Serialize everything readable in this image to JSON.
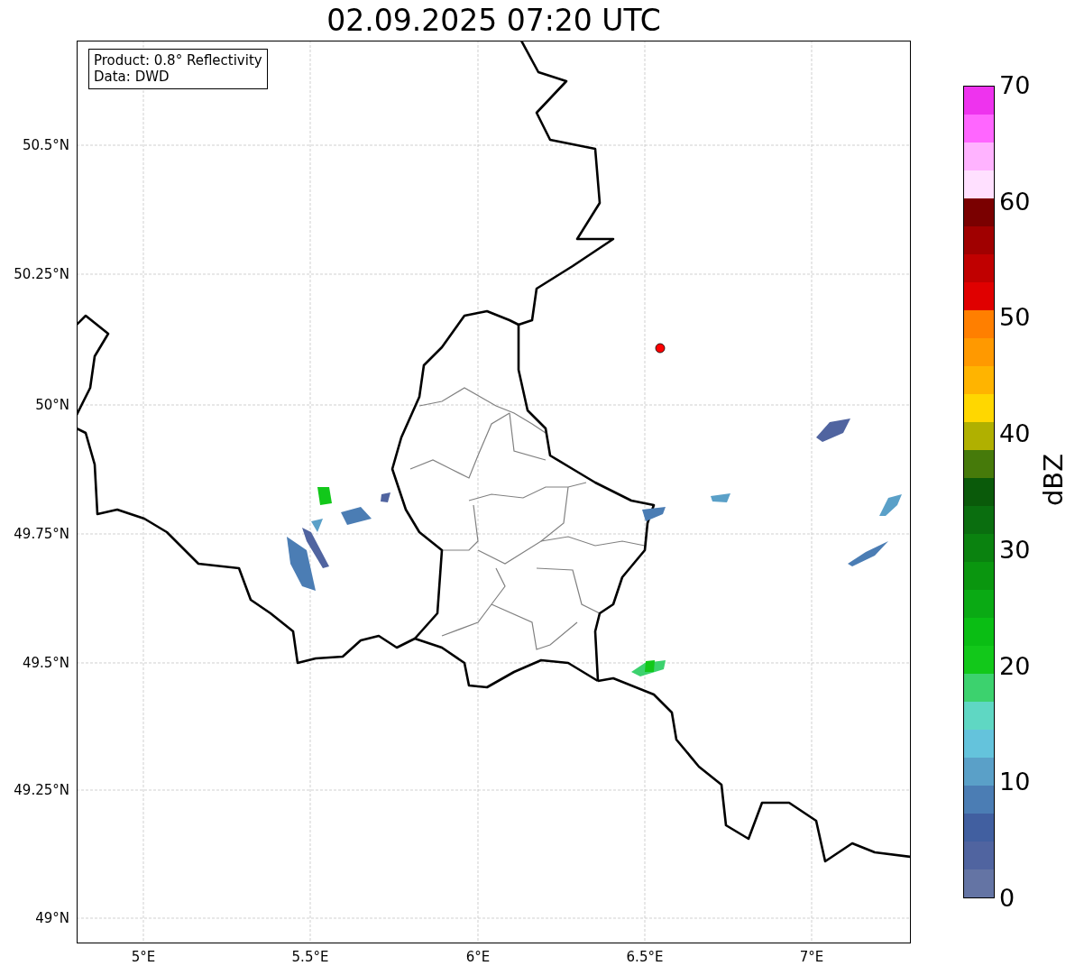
{
  "title": "02.09.2025 07:20 UTC",
  "info_box": [
    "Product: 0.8° Reflectivity",
    "Data: DWD"
  ],
  "map": {
    "y_ticks": [
      "50.5°N",
      "50.25°N",
      "50°N",
      "49.75°N",
      "49.5°N",
      "49.25°N",
      "49°N"
    ],
    "x_ticks": [
      "5°E",
      "5.5°E",
      "6°E",
      "6.5°E",
      "7°E"
    ]
  },
  "colorbar": {
    "label": "dBZ",
    "ticks": [
      "70",
      "60",
      "50",
      "40",
      "30",
      "20",
      "10",
      "0"
    ],
    "bands": [
      {
        "color": "#ee33ee"
      },
      {
        "color": "#ff66ff"
      },
      {
        "color": "#ffb3ff"
      },
      {
        "color": "#ffe0ff"
      },
      {
        "color": "#7a0000"
      },
      {
        "color": "#a00000"
      },
      {
        "color": "#c00000"
      },
      {
        "color": "#e00000"
      },
      {
        "color": "#ff7f00"
      },
      {
        "color": "#ff9900"
      },
      {
        "color": "#ffb400"
      },
      {
        "color": "#ffd700"
      },
      {
        "color": "#b0b000"
      },
      {
        "color": "#467a0a"
      },
      {
        "color": "#0a5a0a"
      },
      {
        "color": "#0a6e0f"
      },
      {
        "color": "#0a820f"
      },
      {
        "color": "#0a960f"
      },
      {
        "color": "#0aaa14"
      },
      {
        "color": "#0abe14"
      },
      {
        "color": "#12c81a"
      },
      {
        "color": "#3cd26e"
      },
      {
        "color": "#5fd7c3"
      },
      {
        "color": "#64c3dc"
      },
      {
        "color": "#5aa0c8"
      },
      {
        "color": "#4b7db4"
      },
      {
        "color": "#415fa0"
      },
      {
        "color": "#5064a0"
      },
      {
        "color": "#6474a4"
      }
    ]
  }
}
